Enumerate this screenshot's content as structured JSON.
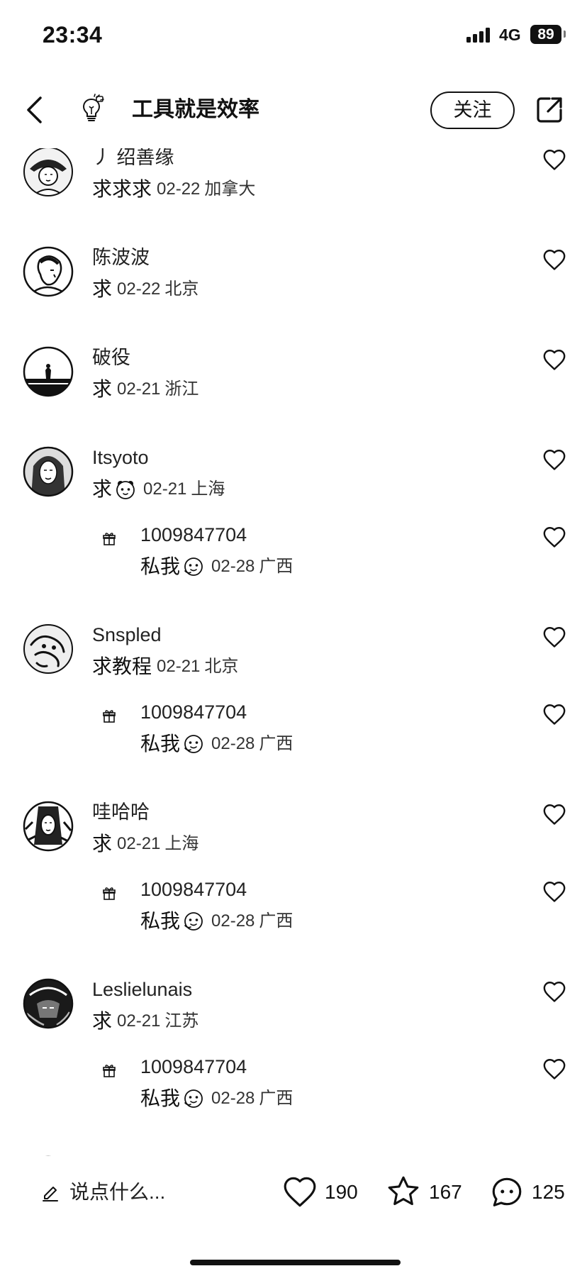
{
  "status_bar": {
    "time": "23:34",
    "network": "4G",
    "battery": "89"
  },
  "header": {
    "title": "工具就是效率",
    "follow_label": "关注",
    "author_icon": "lightbulb-icon"
  },
  "comments": [
    {
      "name": "丿 绍善缘",
      "text": "求求求",
      "date": "02-22",
      "location": "加拿大"
    },
    {
      "name": "陈波波",
      "text": "求",
      "date": "02-22",
      "location": "北京"
    },
    {
      "name": "破役",
      "text": "求",
      "date": "02-21",
      "location": "浙江"
    },
    {
      "name": "Itsyoto",
      "text": "求",
      "sticker": "emoji-face-icon",
      "date": "02-21",
      "location": "上海",
      "reply": {
        "name": "1009847704",
        "text": "私我",
        "sticker": "emoji-face-icon",
        "date": "02-28",
        "location": "广西"
      }
    },
    {
      "name": "Snspled",
      "text": "求教程",
      "date": "02-21",
      "location": "北京",
      "reply": {
        "name": "1009847704",
        "text": "私我",
        "sticker": "emoji-face-icon",
        "date": "02-28",
        "location": "广西"
      }
    },
    {
      "name": "哇哈哈",
      "text": "求",
      "date": "02-21",
      "location": "上海",
      "reply": {
        "name": "1009847704",
        "text": "私我",
        "sticker": "emoji-face-icon",
        "date": "02-28",
        "location": "广西"
      }
    },
    {
      "name": "Leslielunais",
      "text": "求",
      "date": "02-21",
      "location": "江苏",
      "reply": {
        "name": "1009847704",
        "text": "私我",
        "sticker": "emoji-face-icon",
        "date": "02-28",
        "location": "广西"
      }
    }
  ],
  "bottom_bar": {
    "input_placeholder": "说点什么...",
    "likes": "190",
    "collects": "167",
    "comments": "125"
  }
}
